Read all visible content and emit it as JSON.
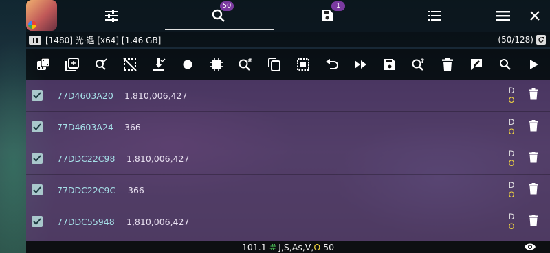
{
  "tabs": {
    "search_badge": "50",
    "saved_badge": "1"
  },
  "status": {
    "process": "[1480] 光·遇 [x64] [1.46 GB]",
    "count": "(50/128)"
  },
  "results": [
    {
      "address": "77D4603A20",
      "value": "1,810,006,427",
      "flag_d": "D",
      "flag_o": "O"
    },
    {
      "address": "77D4603A24",
      "value": "366",
      "flag_d": "D",
      "flag_o": "O"
    },
    {
      "address": "77DDC22C98",
      "value": "1,810,006,427",
      "flag_d": "D",
      "flag_o": "O"
    },
    {
      "address": "77DDC22C9C",
      "value": "366",
      "flag_d": "D",
      "flag_o": "O"
    },
    {
      "address": "77DDC55948",
      "value": "1,810,006,427",
      "flag_d": "D",
      "flag_o": "O"
    }
  ],
  "bottom": {
    "version": "101.1",
    "hash": "#",
    "types_prefix": "J,S,As,V,",
    "types_last": "O",
    "count": "50"
  },
  "colors": {
    "list_bg": "#5c3a70",
    "address": "#a6e0e8",
    "flag_o": "#f0d440",
    "hash": "#4fd05a",
    "badge": "#7a3aa0"
  }
}
